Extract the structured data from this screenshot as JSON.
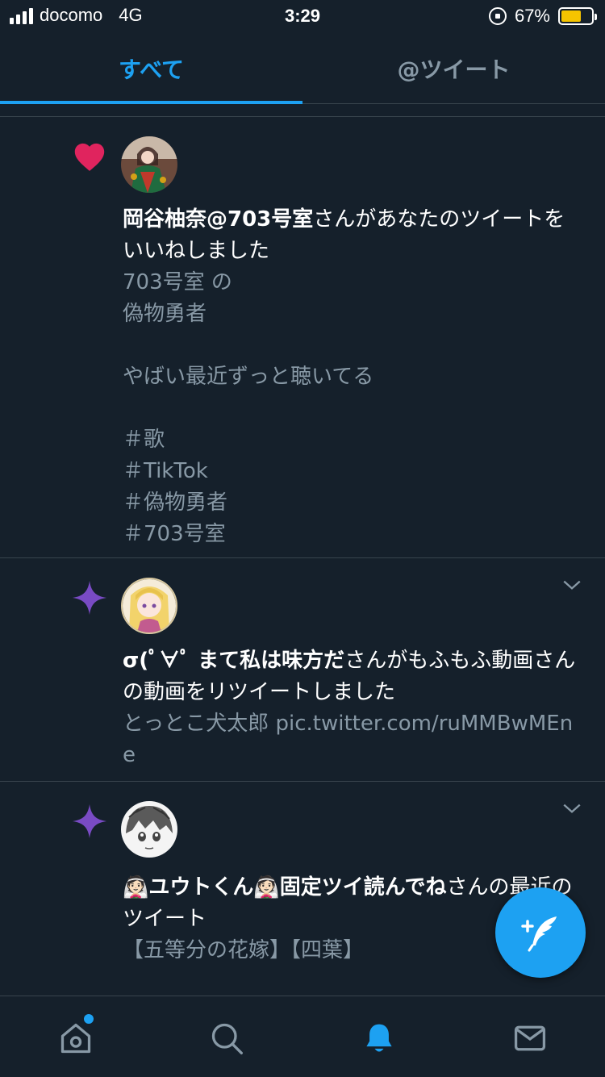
{
  "status_bar": {
    "carrier": "docomo",
    "network": "4G",
    "time": "3:29",
    "battery": "67%",
    "battery_level": 0.67,
    "battery_color": "#f5c400"
  },
  "tabs": [
    {
      "label": "すべて",
      "active": true
    },
    {
      "label": "@ツイート",
      "active": false
    }
  ],
  "notifications": [
    {
      "icon": "heart-icon",
      "icon_color": "#e0245e",
      "user_name": "岡谷柚奈@703号室",
      "action": "さんがあなたのツイートをいいねしました",
      "tweet_text": "703号室 の\n偽物勇者\n\nやばい最近ずっと聴いてる\n\n＃歌\n＃TikTok\n＃偽物勇者\n＃703号室"
    },
    {
      "icon": "sparkle-icon",
      "icon_color": "#794bc4",
      "user_name": "σ(ﾟ∀ﾟ まて私は味方だ",
      "action": "さんがもふもふ動画さんの動画をリツイートしました",
      "tweet_text": "とっとこ犬太郎 pic.twitter.com/ruMMBwMEne"
    },
    {
      "icon": "sparkle-icon",
      "icon_color": "#794bc4",
      "user_name": "👰🏻ユウトくん👰🏻固定ツイ読んでね",
      "action": "さんの最近のツイート",
      "tweet_text": "【五等分の花嫁】【四葉】"
    }
  ],
  "colors": {
    "background": "#15202b",
    "accent": "#1da1f2",
    "muted_text": "#8899a6",
    "divider": "#38444d"
  },
  "bottom_nav": [
    "home-icon",
    "search-icon",
    "notifications-icon",
    "messages-icon"
  ]
}
